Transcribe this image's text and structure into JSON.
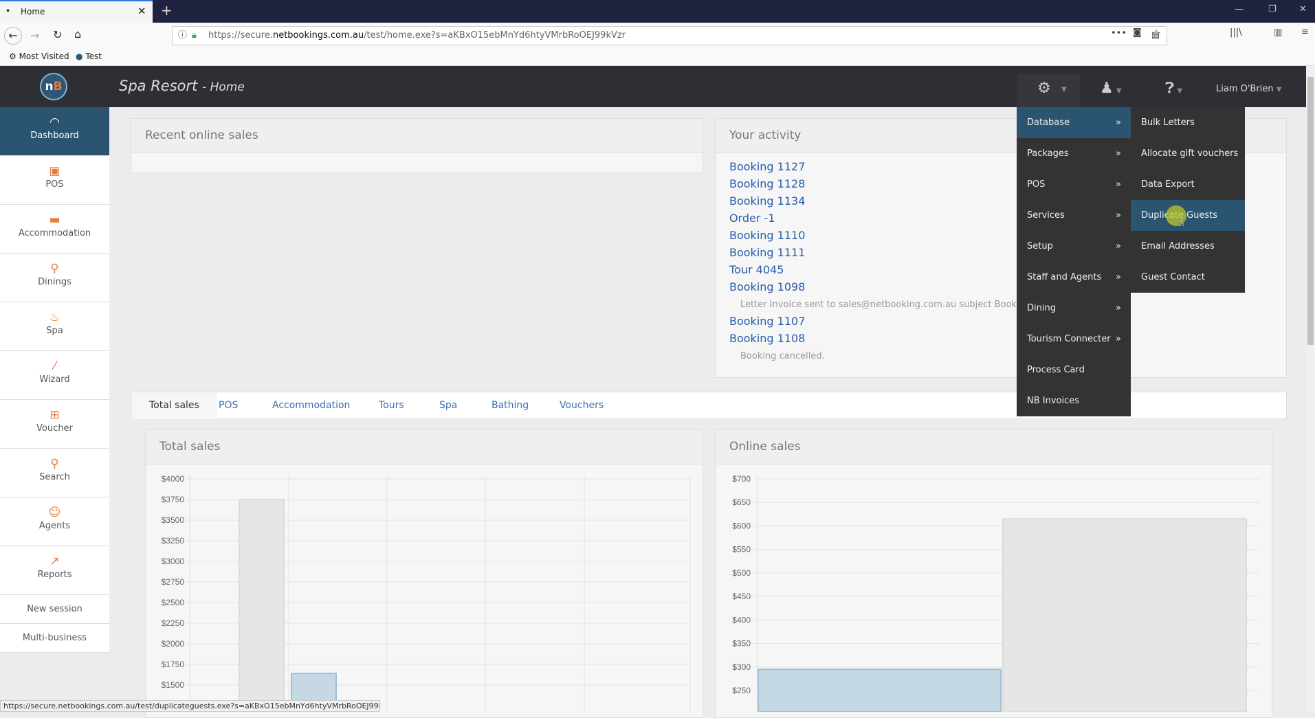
{
  "browser": {
    "tab_title": "Home",
    "url_prefix": "https://secure.",
    "url_domain": "netbookings.com.au",
    "url_path": "/test/home.exe?s=aKBxO15ebMnYd6htyVMrbRoOEJ99kVzr",
    "bookmarks": [
      "Most Visited",
      "Test"
    ],
    "status_url": "https://secure.netbookings.com.au/test/duplicateguests.exe?s=aKBxO15ebMnYd6htyVMrbRoOEJ99kVzr"
  },
  "header": {
    "logo": "nB",
    "title": "Spa Resort",
    "subtitle": "- Home",
    "user": "Liam O'Brien"
  },
  "sidebar": {
    "items": [
      {
        "label": "Dashboard",
        "icon": "dashboard-icon",
        "glyph": "◠"
      },
      {
        "label": "POS",
        "icon": "pos-icon",
        "glyph": "▣"
      },
      {
        "label": "Accommodation",
        "icon": "bed-icon",
        "glyph": "▬"
      },
      {
        "label": "Dinings",
        "icon": "dining-icon",
        "glyph": "⚲"
      },
      {
        "label": "Spa",
        "icon": "spa-icon",
        "glyph": "♨"
      },
      {
        "label": "Wizard",
        "icon": "wand-icon",
        "glyph": "⁄"
      },
      {
        "label": "Voucher",
        "icon": "gift-icon",
        "glyph": "⊞"
      },
      {
        "label": "Search",
        "icon": "search-icon",
        "glyph": "⚲"
      },
      {
        "label": "Agents",
        "icon": "agent-icon",
        "glyph": "☺"
      },
      {
        "label": "Reports",
        "icon": "chart-icon",
        "glyph": "↗"
      }
    ],
    "links": [
      "New session",
      "Multi-business"
    ]
  },
  "recent": {
    "title": "Recent online sales"
  },
  "activity": {
    "title": "Your activity",
    "items": [
      {
        "link": "Booking 1127"
      },
      {
        "link": "Booking 1128"
      },
      {
        "link": "Booking 1134"
      },
      {
        "link": "Order -1"
      },
      {
        "link": "Booking 1110"
      },
      {
        "link": "Booking 1111"
      },
      {
        "link": "Tour 4045"
      },
      {
        "link": "Booking 1098",
        "note": "Letter Invoice sent to sales@netbooking.com.au subject Booking"
      },
      {
        "link": "Booking 1107"
      },
      {
        "link": "Booking 1108",
        "note": "Booking cancelled."
      }
    ]
  },
  "tabs": [
    "Total sales",
    "POS",
    "Accommodation",
    "Tours",
    "Spa",
    "Bathing",
    "Vouchers"
  ],
  "menu": {
    "items": [
      {
        "label": "Database",
        "sub": "»"
      },
      {
        "label": "Packages",
        "sub": "»"
      },
      {
        "label": "POS",
        "sub": "»"
      },
      {
        "label": "Services",
        "sub": "»"
      },
      {
        "label": "Setup",
        "sub": "»"
      },
      {
        "label": "Staff and Agents",
        "sub": "»"
      },
      {
        "label": "Dining",
        "sub": "»"
      },
      {
        "label": "Tourism Connecter",
        "sub": "»"
      },
      {
        "label": "Process Card"
      },
      {
        "label": "NB Invoices"
      }
    ],
    "submenu": [
      "Bulk Letters",
      "Allocate gift vouchers",
      "Data Export",
      "Duplicate Guests",
      "Email Addresses",
      "Guest Contact"
    ],
    "active": "Database",
    "hovered": "Duplicate Guests"
  },
  "colors": {
    "accent": "#2a5470",
    "orange": "#e87b3c",
    "link": "#2a5ca8",
    "bar_grey": "#e6e6e6",
    "bar_blue": "#c5d9e4"
  },
  "chart_data": [
    {
      "type": "bar",
      "title": "Total sales",
      "yticks": [
        "$4000",
        "$3750",
        "$3500",
        "$3250",
        "$3000",
        "$2750",
        "$2500",
        "$2250",
        "$2000",
        "$1750",
        "$1500"
      ],
      "ylim": [
        1500,
        4000
      ],
      "values": [
        3750,
        1640
      ],
      "bar_colors": [
        "grey",
        "blue"
      ],
      "grid": true
    },
    {
      "type": "bar",
      "title": "Online sales",
      "yticks": [
        "$700",
        "$650",
        "$600",
        "$550",
        "$500",
        "$450",
        "$400",
        "$350",
        "$300",
        "$250"
      ],
      "ylim": [
        250,
        700
      ],
      "values": [
        295,
        615
      ],
      "bar_colors": [
        "blue",
        "grey"
      ],
      "grid": true
    }
  ]
}
